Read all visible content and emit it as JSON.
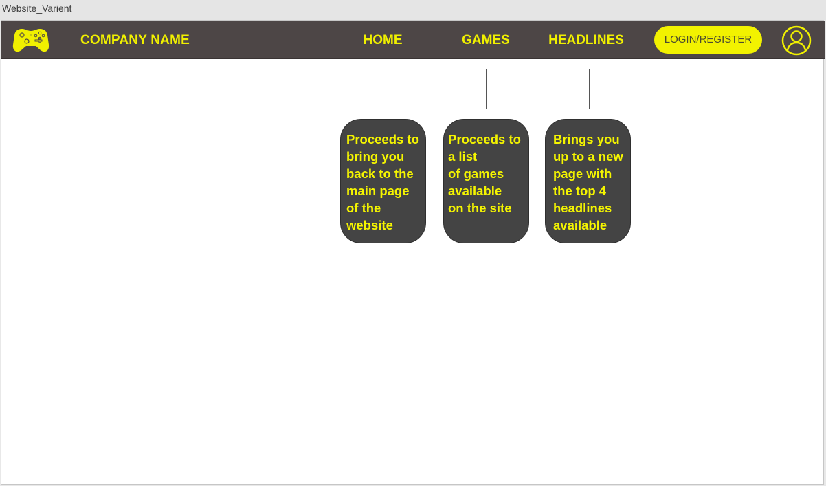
{
  "window": {
    "title": "Website_Varient"
  },
  "header": {
    "logo_icon": "gamepad-icon",
    "company_name": "COMPANY NAME",
    "nav": [
      {
        "label": "HOME"
      },
      {
        "label": "GAMES"
      },
      {
        "label": "HEADLINES"
      }
    ],
    "login_label": "LOGIN/REGISTER",
    "profile_icon": "user-profile-icon"
  },
  "annotations": [
    {
      "text": "Proceeds to\nbring you\nback to the\nmain page\nof the\nwebsite"
    },
    {
      "text": "Proceeds to\na list\nof games\navailable\non the site"
    },
    {
      "text": "Brings you\nup to a new\npage with\nthe top 4\nheadlines\navailable"
    }
  ],
  "colors": {
    "navbar": "#4d4646",
    "accent": "#f0f000",
    "bubble": "#444444",
    "canvas": "#ffffff"
  }
}
